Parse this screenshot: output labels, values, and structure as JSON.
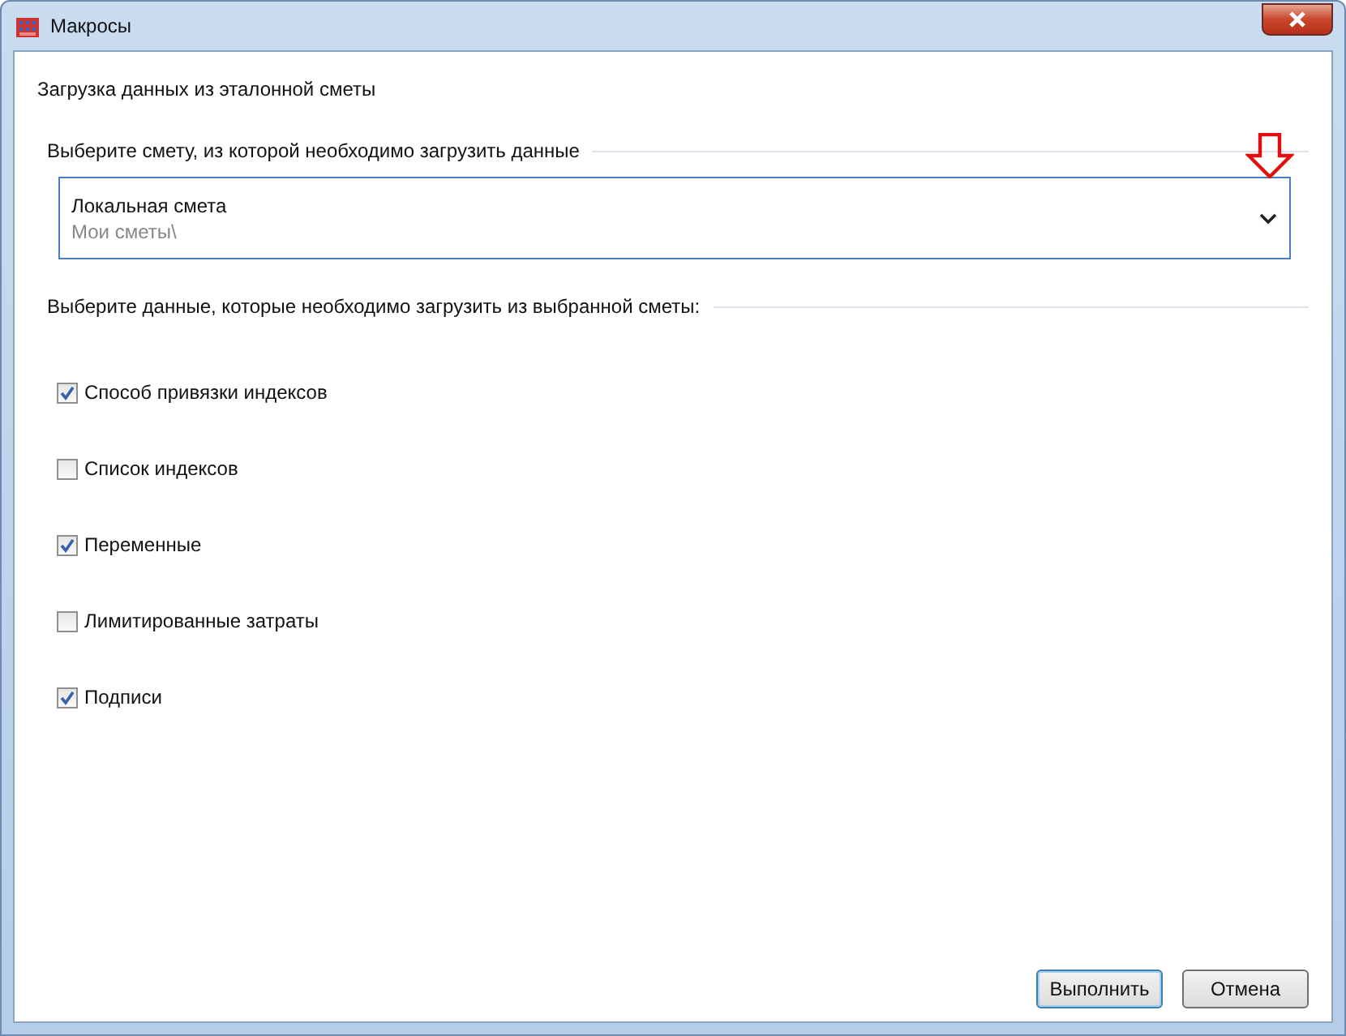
{
  "window": {
    "title": "Макросы"
  },
  "heading": "Загрузка данных из эталонной сметы",
  "source_group": {
    "label": "Выберите смету, из которой необходимо загрузить данные",
    "dropdown": {
      "value": "Локальная смета",
      "path": "Мои сметы\\"
    }
  },
  "data_group": {
    "label": "Выберите данные, которые необходимо загрузить из выбранной сметы:"
  },
  "options": [
    {
      "label": "Способ привязки индексов",
      "checked": true
    },
    {
      "label": "Список индексов",
      "checked": false
    },
    {
      "label": "Переменные",
      "checked": true
    },
    {
      "label": "Лимитированные затраты",
      "checked": false
    },
    {
      "label": "Подписи",
      "checked": true
    }
  ],
  "buttons": [
    {
      "label": "Выполнить",
      "default": true
    },
    {
      "label": "Отмена",
      "default": false
    }
  ]
}
